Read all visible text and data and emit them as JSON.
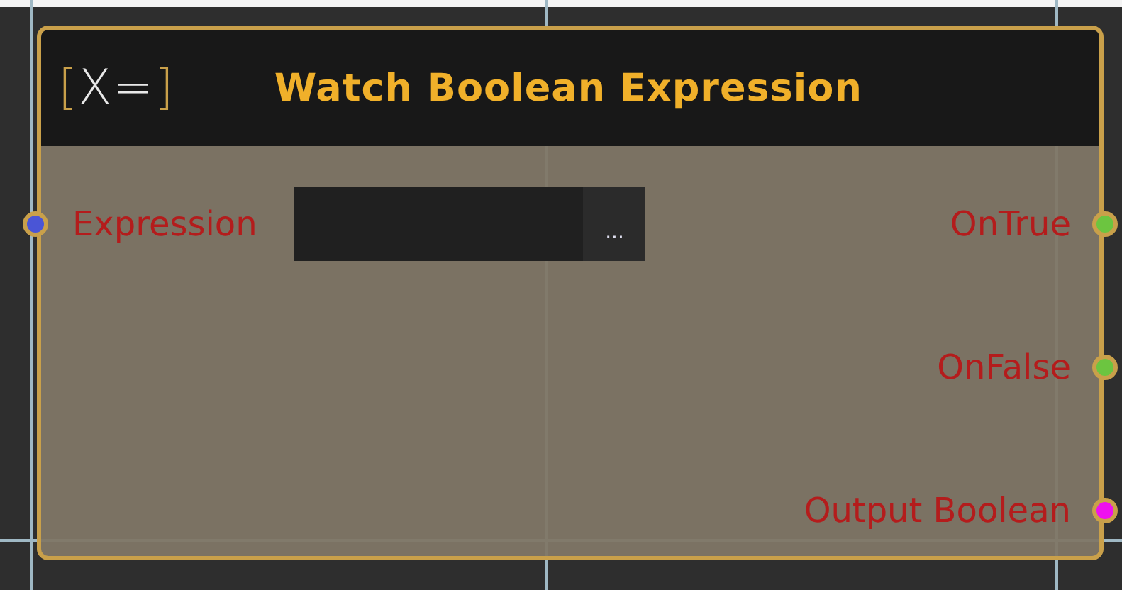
{
  "node": {
    "icon": "[X=]",
    "title": "Watch Boolean Expression",
    "inputs": [
      {
        "label": "Expression",
        "color": "#4a55d6",
        "field": {
          "button": "..."
        }
      }
    ],
    "outputs": [
      {
        "label": "OnTrue",
        "color": "#6cc540"
      },
      {
        "label": "OnFalse",
        "color": "#6cc540"
      },
      {
        "label": "Output Boolean",
        "color": "#ee11ee"
      }
    ]
  }
}
